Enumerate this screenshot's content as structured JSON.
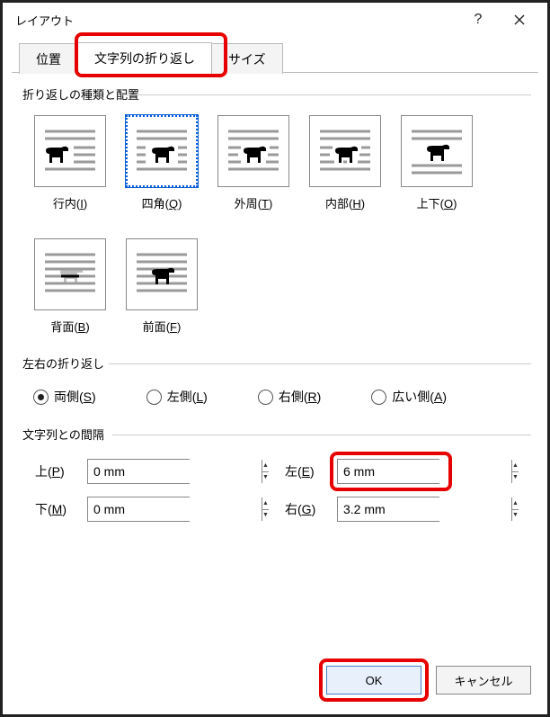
{
  "titlebar": {
    "title": "レイアウト"
  },
  "tabs": {
    "position": "位置",
    "wrap": "文字列の折り返し",
    "size": "サイズ"
  },
  "group_wrap": {
    "title": "折り返しの種類と配置",
    "items": {
      "inline": {
        "label": "行内",
        "key": "I"
      },
      "square": {
        "label": "四角",
        "key": "Q"
      },
      "tight": {
        "label": "外周",
        "key": "T"
      },
      "through": {
        "label": "内部",
        "key": "H"
      },
      "topbot": {
        "label": "上下",
        "key": "O"
      },
      "behind": {
        "label": "背面",
        "key": "B"
      },
      "front": {
        "label": "前面",
        "key": "F"
      }
    }
  },
  "group_side": {
    "title": "左右の折り返し",
    "both": {
      "label": "両側",
      "key": "S"
    },
    "left": {
      "label": "左側",
      "key": "L"
    },
    "right": {
      "label": "右側",
      "key": "R"
    },
    "widest": {
      "label": "広い側",
      "key": "A"
    }
  },
  "group_spacing": {
    "title": "文字列との間隔",
    "top": {
      "label": "上",
      "key": "P",
      "value": "0 mm"
    },
    "bottom": {
      "label": "下",
      "key": "M",
      "value": "0 mm"
    },
    "left": {
      "label": "左",
      "key": "E",
      "value": "6 mm"
    },
    "right": {
      "label": "右",
      "key": "G",
      "value": "3.2 mm"
    }
  },
  "footer": {
    "ok": "OK",
    "cancel": "キャンセル"
  }
}
